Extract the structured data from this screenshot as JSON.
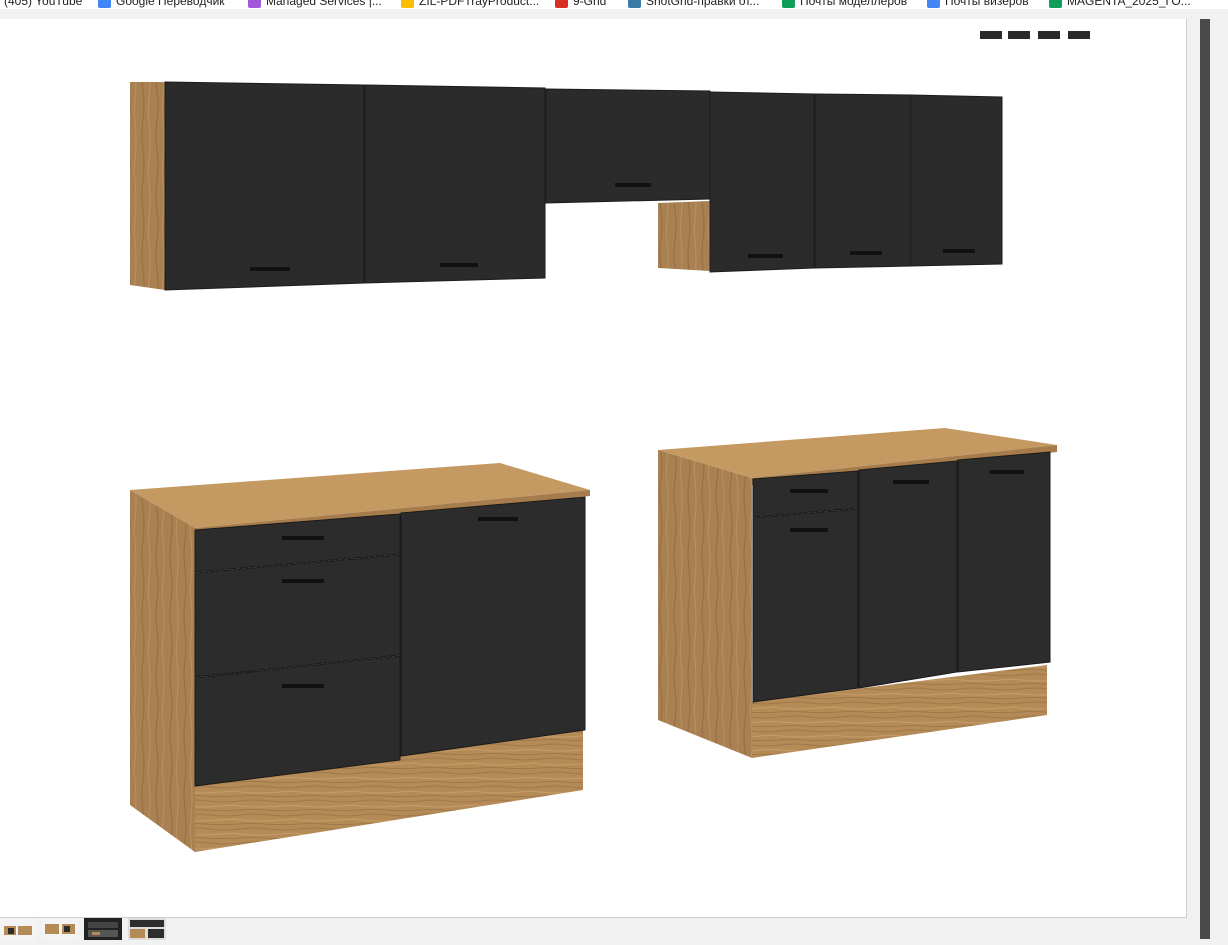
{
  "bookmarks": [
    {
      "label": "(405) YouTube",
      "icon": "youtube-icon",
      "color": "#ff0000"
    },
    {
      "label": "Google Переводчик",
      "icon": "translate-icon",
      "color": "#4285f4"
    },
    {
      "label": "Managed Services |...",
      "icon": "managed-services-icon",
      "color": "#a259d9"
    },
    {
      "label": "ZIL-PDFTrayProduct...",
      "icon": "drive-icon",
      "color": "#fbbc04"
    },
    {
      "label": "9-Grid",
      "icon": "pdf-icon",
      "color": "#d93025"
    },
    {
      "label": "ShotGrid-правки от...",
      "icon": "shotgrid-icon",
      "color": "#3a7ca5"
    },
    {
      "label": "Почты моделлеров",
      "icon": "sheets-icon",
      "color": "#0f9d58"
    },
    {
      "label": "Почты визеров",
      "icon": "docs-icon",
      "color": "#4285f4"
    },
    {
      "label": "MAGENTA_2025_ГО...",
      "icon": "sheets-icon",
      "color": "#0f9d58"
    }
  ],
  "viewer": {
    "image_description": "kitchen-set-render",
    "colors": {
      "front": "#2c2c2c",
      "oak": "#b48a56",
      "background": "#ffffff"
    }
  },
  "thumbnails": [
    {
      "name": "thumbnail-1"
    },
    {
      "name": "thumbnail-2"
    },
    {
      "name": "thumbnail-3"
    },
    {
      "name": "thumbnail-4"
    }
  ]
}
